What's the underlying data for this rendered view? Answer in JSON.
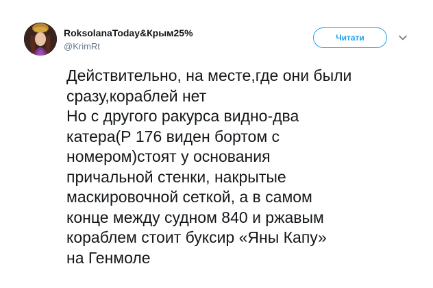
{
  "author": {
    "display_name": "RoksolanaToday&Крым25%",
    "username": "@KrimRt",
    "avatar_icon": "portrait-avatar"
  },
  "actions": {
    "follow_label": "Читати",
    "menu_icon": "chevron-down-icon"
  },
  "tweet": {
    "text": "Действительно, на месте,где они были\nсразу,кораблей нет\nНо с другого ракурса видно-два\nкатера(Р 176 виден бортом с\nномером)стоят у основания\nпричальной стенки, накрытые\nмаскировочной сеткой, а в самом\nконце между судном 840 и ржавым\nкораблем стоит буксир «Яны Капу»\nна Генмоле"
  },
  "colors": {
    "accent": "#1da1f2",
    "text": "#14171a",
    "secondary_text": "#657786"
  }
}
